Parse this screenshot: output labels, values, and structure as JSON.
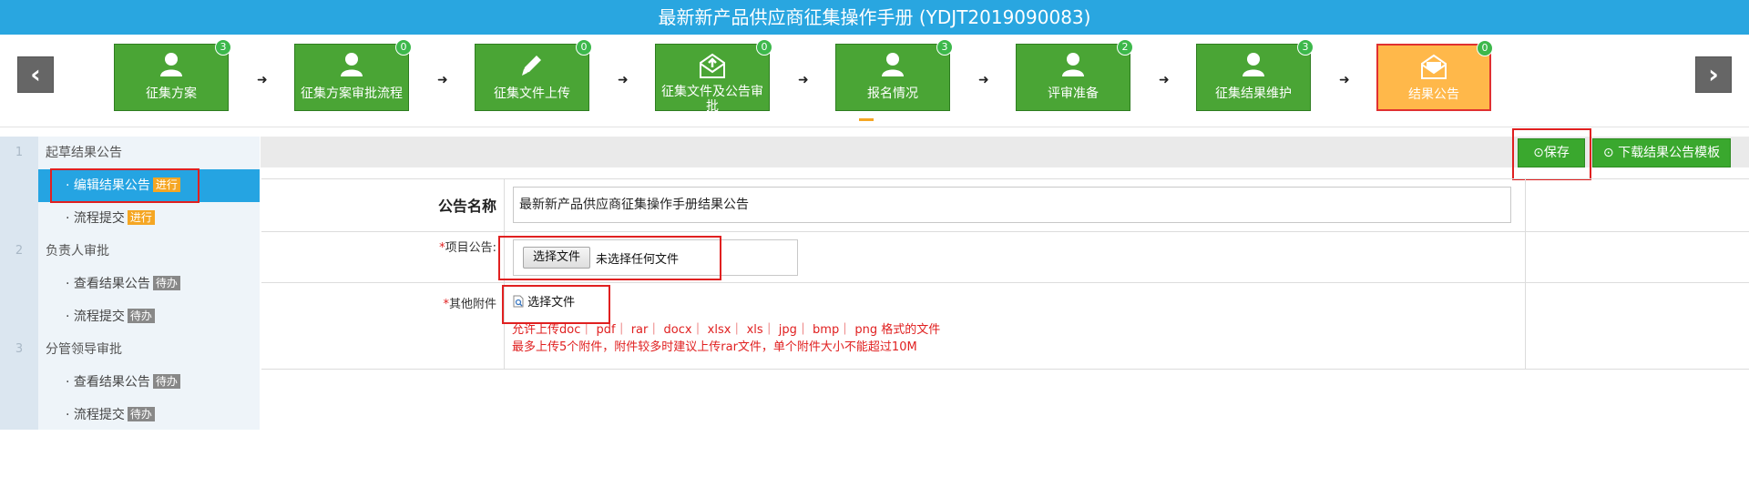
{
  "title": "最新新产品供应商征集操作手册 (YDJT2019090083)",
  "nav": {
    "prev_icon": "chevron-left-icon",
    "next_icon": "chevron-right-icon"
  },
  "steps": [
    {
      "label": "征集方案",
      "count": "3",
      "icon": "user-icon"
    },
    {
      "label": "征集方案审批流程",
      "count": "0",
      "icon": "user-icon"
    },
    {
      "label": "征集文件上传",
      "count": "0",
      "icon": "pencil-icon"
    },
    {
      "label": "征集文件及公告审批",
      "count": "0",
      "icon": "envelope-upload-icon"
    },
    {
      "label": "报名情况",
      "count": "3",
      "icon": "user-icon"
    },
    {
      "label": "评审准备",
      "count": "2",
      "icon": "user-icon"
    },
    {
      "label": "征集结果维护",
      "count": "3",
      "icon": "user-icon"
    },
    {
      "label": "结果公告",
      "count": "0",
      "icon": "envelope-icon"
    }
  ],
  "step_separator": "➜",
  "sidebar": {
    "groups": [
      {
        "num": "1",
        "title": "起草结果公告",
        "items": [
          {
            "label": "· 编辑结果公告",
            "tag": "进行",
            "tag_type": "run",
            "selected": true
          },
          {
            "label": "· 流程提交",
            "tag": "进行",
            "tag_type": "run"
          }
        ]
      },
      {
        "num": "2",
        "title": "负责人审批",
        "items": [
          {
            "label": "· 查看结果公告",
            "tag": "待办",
            "tag_type": "todo"
          },
          {
            "label": "· 流程提交",
            "tag": "待办",
            "tag_type": "todo"
          }
        ]
      },
      {
        "num": "3",
        "title": "分管领导审批",
        "items": [
          {
            "label": "· 查看结果公告",
            "tag": "待办",
            "tag_type": "todo"
          },
          {
            "label": "· 流程提交",
            "tag": "待办",
            "tag_type": "todo"
          }
        ]
      }
    ]
  },
  "toolbar": {
    "save_label": "保存",
    "download_label": "下载结果公告模板",
    "button_icon": "arrow-circle-right-icon"
  },
  "form": {
    "name_label": "公告名称",
    "name_value": "最新新产品供应商征集操作手册结果公告",
    "project_label": "项目公告:",
    "project_required": "*",
    "choose_file_label": "选择文件",
    "no_file_text": "未选择任何文件",
    "attach_label": "其他附件",
    "attach_required": "*",
    "attach_choose_label": "选择文件",
    "attach_icon": "file-search-icon",
    "hint_line1": "允许上传doc｜ pdf｜ rar｜ docx｜ xlsx｜ xls｜ jpg｜ bmp｜ png 格式的文件",
    "hint_line2": "最多上传5个附件，附件较多时建议上传rar文件，单个附件大小不能超过10M"
  },
  "colors": {
    "header_blue": "#29a6e0",
    "step_green": "#4aa535",
    "step_active": "#ffb84a",
    "highlight_red": "#e02020",
    "sidebar_selected": "#25a4e2"
  }
}
